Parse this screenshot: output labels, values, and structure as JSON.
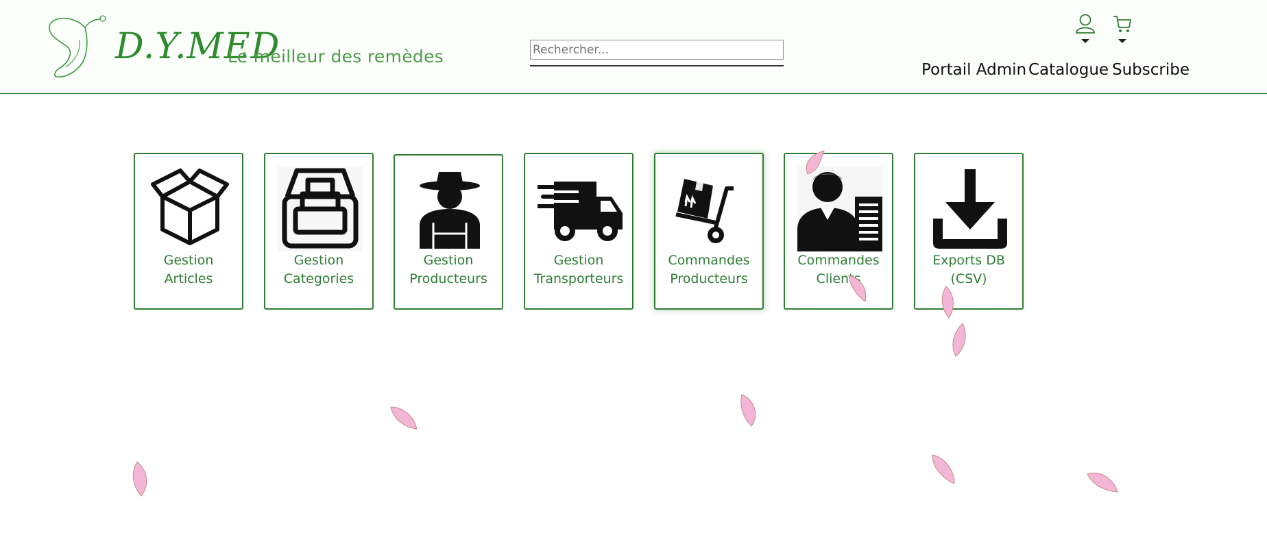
{
  "brand": {
    "name": "D.Y.MED",
    "tagline": "Le meilleur des remèdes"
  },
  "search": {
    "placeholder": "Rechercher..."
  },
  "nav": {
    "admin": "Portail Admin",
    "catalogue": "Catalogue",
    "subscribe": "Subscribe"
  },
  "header_icons": [
    "user-icon",
    "cart-icon"
  ],
  "cards": [
    {
      "line1": "Gestion",
      "line2": "Articles",
      "icon": "open-box-icon"
    },
    {
      "line1": "Gestion",
      "line2": "Categories",
      "icon": "archive-tray-icon"
    },
    {
      "line1": "Gestion",
      "line2": "Producteurs",
      "icon": "farmer-icon"
    },
    {
      "line1": "Gestion",
      "line2": "Transporteurs",
      "icon": "delivery-truck-icon"
    },
    {
      "line1": "Commandes",
      "line2": "Producteurs",
      "icon": "hand-truck-icon"
    },
    {
      "line1": "Commandes",
      "line2": "Clients",
      "icon": "client-list-icon"
    },
    {
      "line1": "Exports DB",
      "line2": "(CSV)",
      "icon": "download-icon"
    }
  ],
  "colors": {
    "accent": "#2e7d32",
    "brand": "#2e8b2e",
    "petal": "#f4b6d6"
  }
}
